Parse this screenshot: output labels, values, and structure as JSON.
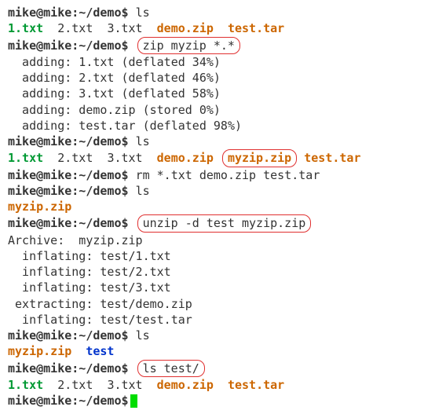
{
  "prompt": "mike@mike:~/demo$",
  "cmd_ls1": "ls",
  "files1_1": "1.txt",
  "files1_2": "2.txt",
  "files1_3": "3.txt",
  "files1_demo": "demo.zip",
  "files1_tar": "test.tar",
  "cmd_zip": "zip myzip *.*",
  "zip_add1": "  adding: 1.txt (deflated 34%)",
  "zip_add2": "  adding: 2.txt (deflated 46%)",
  "zip_add3": "  adding: 3.txt (deflated 58%)",
  "zip_add4": "  adding: demo.zip (stored 0%)",
  "zip_add5": "  adding: test.tar (deflated 98%)",
  "cmd_ls2": "ls",
  "files2_1": "1.txt",
  "files2_2": "2.txt",
  "files2_3": "3.txt",
  "files2_demo": "demo.zip",
  "files2_myzip": "myzip.zip",
  "files2_tar": "test.tar",
  "cmd_rm": "rm *.txt demo.zip test.tar",
  "cmd_ls3": "ls",
  "files3_myzip": "myzip.zip",
  "cmd_unzip": "unzip -d test myzip.zip",
  "unzip_arch": "Archive:  myzip.zip",
  "unzip_1": "  inflating: test/1.txt",
  "unzip_2": "  inflating: test/2.txt",
  "unzip_3": "  inflating: test/3.txt",
  "unzip_4": " extracting: test/demo.zip",
  "unzip_5": "  inflating: test/test.tar",
  "cmd_ls4": "ls",
  "files4_myzip": "myzip.zip",
  "files4_test": "test",
  "cmd_ls5": "ls test/",
  "files5_1": "1.txt",
  "files5_2": "2.txt",
  "files5_3": "3.txt",
  "files5_demo": "demo.zip",
  "files5_tar": "test.tar",
  "sp1": "  ",
  "sp2": "   ",
  "sp3": " "
}
